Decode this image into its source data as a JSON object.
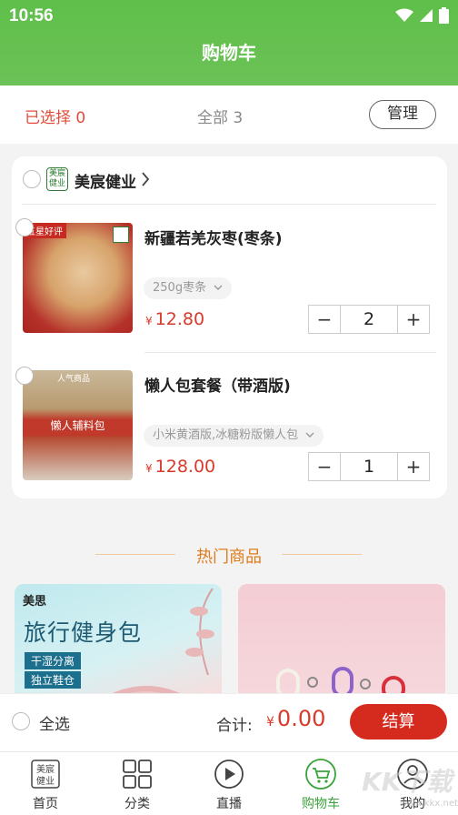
{
  "status_bar": {
    "time": "10:56"
  },
  "header": {
    "title": "购物车"
  },
  "summary": {
    "selected": "已选择 0",
    "total": "全部 3",
    "manage_label": "管理"
  },
  "store": {
    "logo_text": "美宸健业",
    "name": "美宸健业"
  },
  "items": [
    {
      "name": "新疆若羌灰枣(枣条)",
      "variant": "250g枣条",
      "currency": "¥",
      "price": "12.80",
      "quantity": "2",
      "badge": "五星好评"
    },
    {
      "name": "懒人包套餐（带酒版)",
      "variant": "小米黄酒版,冰糖粉版懒人包",
      "currency": "¥",
      "price": "128.00",
      "quantity": "1",
      "badge": "人气商品",
      "banner": "懒人辅料包"
    }
  ],
  "hot": {
    "title": "热门商品"
  },
  "promos": [
    {
      "brand": "美思",
      "title": "旅行健身包",
      "tag1": "干湿分离",
      "tag2": "独立鞋仓"
    }
  ],
  "checkout": {
    "select_all": "全选",
    "total_label": "合计:",
    "currency": "¥",
    "total_value": "0.00",
    "button_label": "结算"
  },
  "tabs": [
    {
      "label": "首页",
      "icon": "home-logo-icon"
    },
    {
      "label": "分类",
      "icon": "grid-icon"
    },
    {
      "label": "直播",
      "icon": "play-icon"
    },
    {
      "label": "购物车",
      "icon": "cart-icon"
    },
    {
      "label": "我的",
      "icon": "user-icon"
    }
  ],
  "watermark": {
    "text": "KK下载",
    "site": "www.kkx.net"
  },
  "colors": {
    "header_green": "#5fbf4a",
    "price_red": "#d93a2b",
    "checkout_red": "#d52b1e",
    "active_green": "#3aa33a",
    "hot_orange": "#e07b1a"
  }
}
